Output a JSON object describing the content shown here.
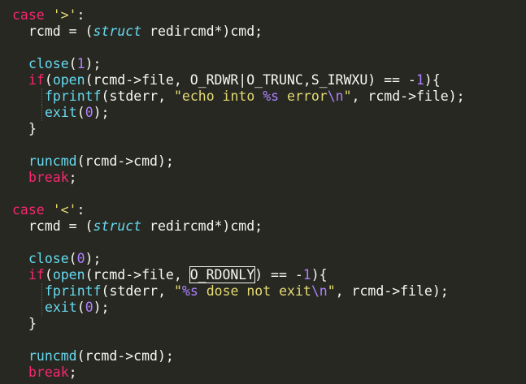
{
  "colors": {
    "background": "#272822",
    "keyword": "#F92672",
    "string": "#E6DB74",
    "function": "#66D9EF",
    "type": "#66D9EF",
    "number": "#AE81FF",
    "plain": "#F8F8F2"
  },
  "code": [
    {
      "indent": 0,
      "tokens": [
        {
          "t": "case",
          "k": "kw"
        },
        {
          "t": " ",
          "k": "plain"
        },
        {
          "t": "'>'",
          "k": "str"
        },
        {
          "t": ":",
          "k": "plain"
        }
      ]
    },
    {
      "indent": 1,
      "tokens": [
        {
          "t": "rcmd = (",
          "k": "plain"
        },
        {
          "t": "struct",
          "k": "type"
        },
        {
          "t": " redircmd*)cmd;",
          "k": "plain"
        }
      ]
    },
    {
      "indent": 1,
      "tokens": []
    },
    {
      "indent": 1,
      "tokens": [
        {
          "t": "close",
          "k": "fn"
        },
        {
          "t": "(",
          "k": "plain"
        },
        {
          "t": "1",
          "k": "num"
        },
        {
          "t": ");",
          "k": "plain"
        }
      ]
    },
    {
      "indent": 1,
      "tokens": [
        {
          "t": "if",
          "k": "kw"
        },
        {
          "t": "(",
          "k": "plain"
        },
        {
          "t": "open",
          "k": "fn"
        },
        {
          "t": "(rcmd->file, O_RDWR|O_TRUNC,S_IRWXU) == -",
          "k": "plain"
        },
        {
          "t": "1",
          "k": "num"
        },
        {
          "t": "){",
          "k": "plain"
        }
      ]
    },
    {
      "indent": 2,
      "tokens": [
        {
          "t": "fprintf",
          "k": "fn"
        },
        {
          "t": "(stderr, ",
          "k": "plain"
        },
        {
          "t": "\"echo into ",
          "k": "str"
        },
        {
          "t": "%s",
          "k": "num"
        },
        {
          "t": " error",
          "k": "str"
        },
        {
          "t": "\\n",
          "k": "num"
        },
        {
          "t": "\"",
          "k": "str"
        },
        {
          "t": ", rcmd->file);",
          "k": "plain"
        }
      ]
    },
    {
      "indent": 2,
      "tokens": [
        {
          "t": "exit",
          "k": "fn"
        },
        {
          "t": "(",
          "k": "plain"
        },
        {
          "t": "0",
          "k": "num"
        },
        {
          "t": ");",
          "k": "plain"
        }
      ]
    },
    {
      "indent": 1,
      "tokens": [
        {
          "t": "}",
          "k": "plain"
        }
      ]
    },
    {
      "indent": 1,
      "tokens": []
    },
    {
      "indent": 1,
      "tokens": [
        {
          "t": "runcmd",
          "k": "fn"
        },
        {
          "t": "(rcmd->cmd);",
          "k": "plain"
        }
      ]
    },
    {
      "indent": 1,
      "tokens": [
        {
          "t": "break",
          "k": "kw"
        },
        {
          "t": ";",
          "k": "plain"
        }
      ]
    },
    {
      "indent": 0,
      "tokens": []
    },
    {
      "indent": 0,
      "tokens": [
        {
          "t": "case",
          "k": "kw"
        },
        {
          "t": " ",
          "k": "plain"
        },
        {
          "t": "'<'",
          "k": "str"
        },
        {
          "t": ":",
          "k": "plain"
        }
      ]
    },
    {
      "indent": 1,
      "tokens": [
        {
          "t": "rcmd = (",
          "k": "plain"
        },
        {
          "t": "struct",
          "k": "type"
        },
        {
          "t": " redircmd*)cmd;",
          "k": "plain"
        }
      ]
    },
    {
      "indent": 1,
      "tokens": []
    },
    {
      "indent": 1,
      "tokens": [
        {
          "t": "close",
          "k": "fn"
        },
        {
          "t": "(",
          "k": "plain"
        },
        {
          "t": "0",
          "k": "num"
        },
        {
          "t": ");",
          "k": "plain"
        }
      ]
    },
    {
      "indent": 1,
      "tokens": [
        {
          "t": "if",
          "k": "kw"
        },
        {
          "t": "(",
          "k": "plain"
        },
        {
          "t": "open",
          "k": "fn"
        },
        {
          "t": "(rcmd->file, ",
          "k": "plain"
        },
        {
          "t": "O_RDONLY",
          "k": "boxed"
        },
        {
          "t": ") == -",
          "k": "plain"
        },
        {
          "t": "1",
          "k": "num"
        },
        {
          "t": "){",
          "k": "plain"
        }
      ]
    },
    {
      "indent": 2,
      "tokens": [
        {
          "t": "fprintf",
          "k": "fn"
        },
        {
          "t": "(stderr, ",
          "k": "plain"
        },
        {
          "t": "\"",
          "k": "str"
        },
        {
          "t": "%s",
          "k": "num"
        },
        {
          "t": " dose not exit",
          "k": "str"
        },
        {
          "t": "\\n",
          "k": "num"
        },
        {
          "t": "\"",
          "k": "str"
        },
        {
          "t": ", rcmd->file);",
          "k": "plain"
        }
      ]
    },
    {
      "indent": 2,
      "tokens": [
        {
          "t": "exit",
          "k": "fn"
        },
        {
          "t": "(",
          "k": "plain"
        },
        {
          "t": "0",
          "k": "num"
        },
        {
          "t": ");",
          "k": "plain"
        }
      ]
    },
    {
      "indent": 1,
      "tokens": [
        {
          "t": "}",
          "k": "plain"
        }
      ]
    },
    {
      "indent": 1,
      "tokens": []
    },
    {
      "indent": 1,
      "tokens": [
        {
          "t": "runcmd",
          "k": "fn"
        },
        {
          "t": "(rcmd->cmd);",
          "k": "plain"
        }
      ]
    },
    {
      "indent": 1,
      "tokens": [
        {
          "t": "break",
          "k": "kw"
        },
        {
          "t": ";",
          "k": "plain"
        }
      ]
    }
  ]
}
